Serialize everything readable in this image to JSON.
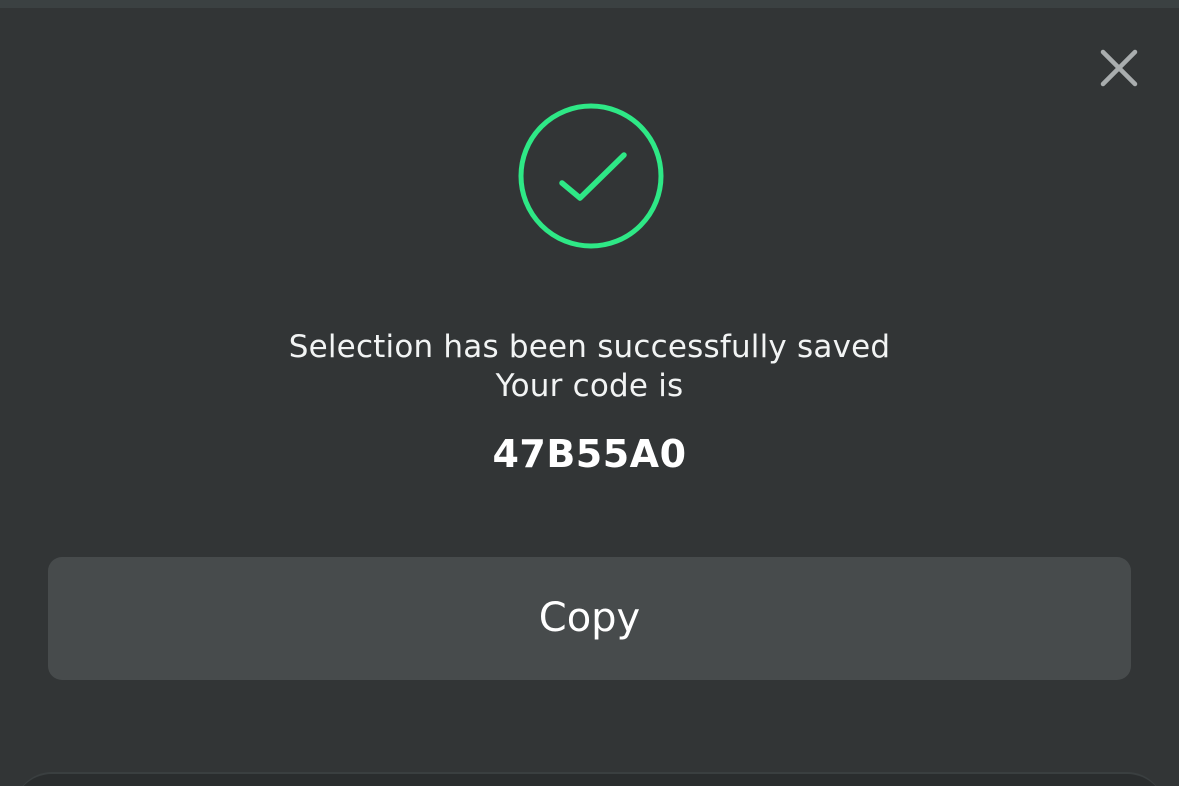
{
  "dialog": {
    "close_icon": "close-icon",
    "success_icon": "check-circle-icon",
    "message_line1": "Selection has been successfully saved",
    "message_line2": "Your code is",
    "code": "47B55A0",
    "copy_label": "Copy"
  },
  "colors": {
    "background": "#323536",
    "accent_success": "#2ee886",
    "button_bg": "#474b4c",
    "text": "#ffffff",
    "close_icon": "#a9adae"
  }
}
